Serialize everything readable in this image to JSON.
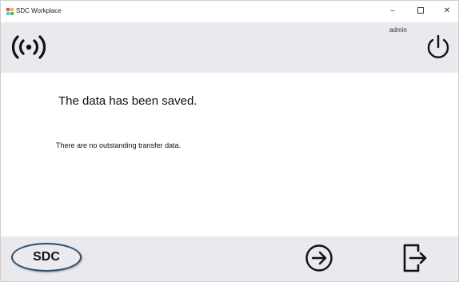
{
  "window": {
    "title": "SDC Workplace",
    "minimize_glyph": "–",
    "close_glyph": "✕"
  },
  "header": {
    "user": "admin",
    "signal_icon": "wireless-signal-icon",
    "power_icon": "power-icon"
  },
  "content": {
    "main_message": "The data has been saved.",
    "sub_message": "There are no outstanding transfer data."
  },
  "footer": {
    "sdc_label": "SDC",
    "next_icon": "arrow-right-circle-icon",
    "exit_icon": "exit-icon"
  },
  "colors": {
    "band_background": "#e9e9ee",
    "content_background": "#ffffff",
    "sdc_border": "#2f4f6f"
  }
}
